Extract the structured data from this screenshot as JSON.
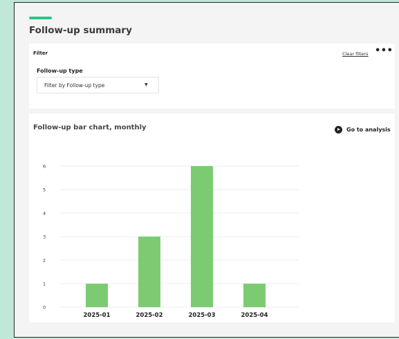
{
  "page": {
    "title": "Follow-up summary"
  },
  "colors": {
    "accent": "#2bc48a",
    "bar": "#7ccb73"
  },
  "filter": {
    "label": "Filter",
    "clear_label": "Clear filters",
    "more_icon": "more-horizontal-icon",
    "followup_type_label": "Follow-up type",
    "followup_type_value": "Filter by Follow-up type",
    "caret_icon": "caret-down-icon"
  },
  "chart_card": {
    "title": "Follow-up bar chart, monthly",
    "analysis_label": "Go to analysis",
    "analysis_icon": "play-circle-icon"
  },
  "chart_data": {
    "type": "bar",
    "categories": [
      "2025-01",
      "2025-02",
      "2025-03",
      "2025-04"
    ],
    "values": [
      1,
      3,
      6,
      1
    ],
    "ylim": [
      0,
      6
    ],
    "yticks": [
      0,
      1,
      2,
      3,
      4,
      5,
      6
    ],
    "grid": true,
    "legend": "none"
  }
}
